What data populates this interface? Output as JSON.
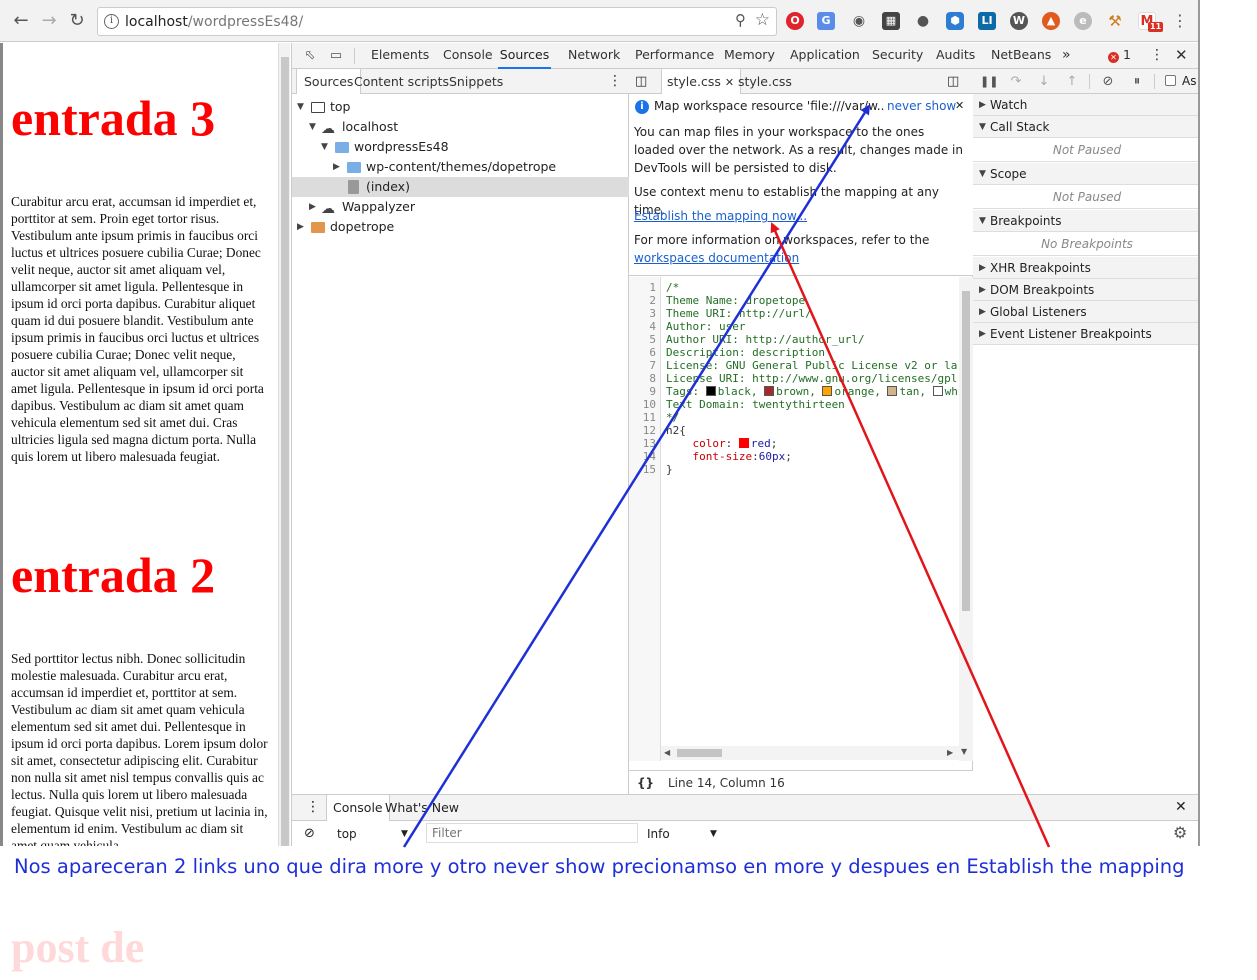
{
  "browser": {
    "url_host": "localhost",
    "url_path": "/wordpressEs48/",
    "gmail_badge": "11"
  },
  "page": {
    "heading1": "entrada 3",
    "para1": "Curabitur arcu erat, accumsan id imperdiet et, porttitor at sem. Proin eget tortor risus. Vestibulum ante ipsum primis in faucibus orci luctus et ultrices posuere cubilia Curae; Donec velit neque, auctor sit amet aliquam vel, ullamcorper sit amet ligula. Pellentesque in ipsum id orci porta dapibus. Curabitur aliquet quam id dui posuere blandit. Vestibulum ante ipsum primis in faucibus orci luctus et ultrices posuere cubilia Curae; Donec velit neque, auctor sit amet aliquam vel, ullamcorper sit amet ligula. Pellentesque in ipsum id orci porta dapibus. Vestibulum ac diam sit amet quam vehicula elementum sed sit amet dui. Cras ultricies ligula sed magna dictum porta. Nulla quis lorem ut libero malesuada feugiat.",
    "heading2": "entrada 2",
    "para2": "Sed porttitor lectus nibh. Donec sollicitudin molestie malesuada. Curabitur arcu erat, accumsan id imperdiet et, porttitor at sem. Vestibulum ac diam sit amet quam vehicula elementum sed sit amet dui. Pellentesque in ipsum id orci porta dapibus. Lorem ipsum dolor sit amet, consectetur adipiscing elit. Curabitur non nulla sit amet nisl tempus convallis quis ac lectus. Nulla quis lorem ut libero malesuada feugiat. Quisque velit nisi, pretium ut lacinia in, elementum id enim. Vestibulum ac diam sit amet quam vehicula",
    "heading3": "post de"
  },
  "devtools": {
    "tabs": [
      "Elements",
      "Console",
      "Sources",
      "Network",
      "Performance",
      "Memory",
      "Application",
      "Security",
      "Audits",
      "NetBeans"
    ],
    "error_count": "1",
    "navigator": {
      "tabs": [
        "Sources",
        "Content scripts",
        "Snippets"
      ],
      "tree": [
        "top",
        "localhost",
        "wordpressEs48",
        "wp-content/themes/dopetrope",
        "(index)",
        "Wappalyzer",
        "dopetrope"
      ]
    },
    "editor": {
      "tabs": [
        "style.css",
        "style.css"
      ],
      "infobar": {
        "message": "Map workspace resource 'file:///var/w...",
        "never_show": "never show",
        "line1": "You can map files in your workspace to the ones loaded over the network. As a result, changes made in DevTools will be persisted to disk.",
        "line2": "Use context menu to establish the mapping at any time.",
        "establish_link": "Establish the mapping now...",
        "more_prefix": "For more information on workspaces, refer to the",
        "docs_link": "workspaces documentation"
      },
      "code": {
        "l1": "/*",
        "l2": "Theme Name: dropetope",
        "l3": "Theme URI: http://url/",
        "l4": "Author: user",
        "l5": "Author URI: http://author_url/",
        "l6": "Description: description",
        "l7": "License: GNU General Public License v2 or la",
        "l8": "License URI: http://www.gnu.org/licenses/gpl",
        "l9_prefix": "Tags: ",
        "l9_black": "black, ",
        "l9_brown": "brown, ",
        "l9_orange": "orange, ",
        "l9_tan": "tan, ",
        "l9_white": "wh",
        "l10": "Text Domain: twentythirteen",
        "l11": "*/",
        "l12": "h2{",
        "l13_prop": "color",
        "l13_val": "red",
        "l14_prop": "font-size",
        "l14_val": "60px",
        "l15": "}"
      },
      "status": "Line 14, Column 16",
      "format_icon": "{}"
    },
    "debugger": {
      "watch": "Watch",
      "call_stack": "Call Stack",
      "not_paused_1": "Not Paused",
      "scope": "Scope",
      "not_paused_2": "Not Paused",
      "breakpoints": "Breakpoints",
      "no_breakpoints": "No Breakpoints",
      "xhr": "XHR Breakpoints",
      "dom": "DOM Breakpoints",
      "global": "Global Listeners",
      "event": "Event Listener Breakpoints",
      "async_label": "As"
    },
    "drawer": {
      "tabs": [
        "Console",
        "What's New"
      ],
      "context": "top",
      "filter_placeholder": "Filter",
      "level": "Info"
    }
  },
  "annotation": {
    "caption": "Nos apareceran 2 links uno que dira more y otro never show precionamso en more y despues en Establish the mapping",
    "blue_color": "#1f2fd8",
    "red_color": "#e4141b"
  }
}
